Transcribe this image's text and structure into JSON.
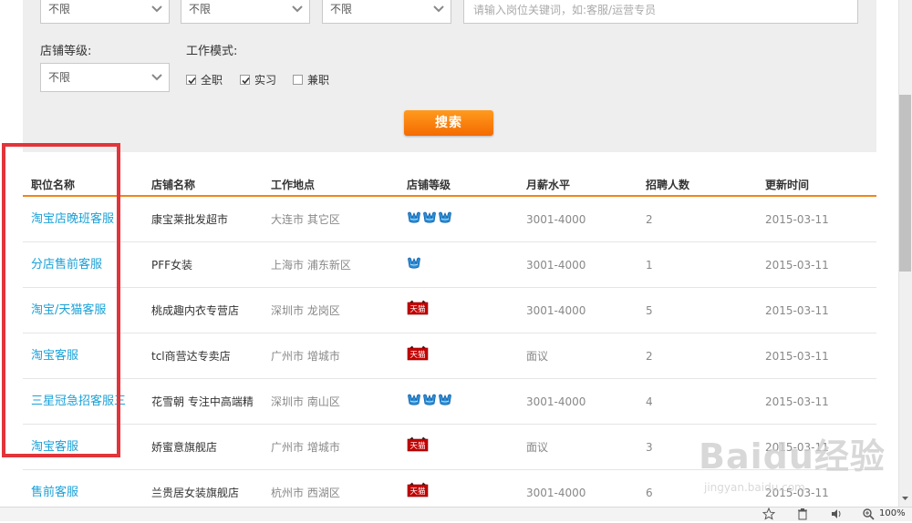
{
  "filters": {
    "top_selects": [
      "不限",
      "不限",
      "不限"
    ],
    "keyword_placeholder": "请输入岗位关键词，如:客服/运营专员",
    "shop_level_label": "店铺等级:",
    "shop_level_value": "不限",
    "work_mode_label": "工作模式:",
    "work_modes": [
      {
        "label": "全职",
        "checked": true
      },
      {
        "label": "实习",
        "checked": true
      },
      {
        "label": "兼职",
        "checked": false
      }
    ],
    "search_button": "搜索"
  },
  "table": {
    "headers": [
      "职位名称",
      "店铺名称",
      "工作地点",
      "店铺等级",
      "月薪水平",
      "招聘人数",
      "更新时间"
    ],
    "rows": [
      {
        "title": "淘宝店晚班客服",
        "shop": "康宝莱批发超市",
        "location": "大连市 其它区",
        "level": {
          "type": "crown",
          "count": 3
        },
        "salary": "3001-4000",
        "count": "2",
        "date": "2015-03-11"
      },
      {
        "title": "分店售前客服",
        "shop": "PFF女装",
        "location": "上海市 浦东新区",
        "level": {
          "type": "crown",
          "count": 1
        },
        "salary": "3001-4000",
        "count": "1",
        "date": "2015-03-11"
      },
      {
        "title": "淘宝/天猫客服",
        "shop": "桃成趣内衣专营店",
        "location": "深圳市 龙岗区",
        "level": {
          "type": "tmall",
          "count": 1
        },
        "salary": "3001-4000",
        "count": "5",
        "date": "2015-03-11"
      },
      {
        "title": "淘宝客服",
        "shop": "tcl商营达专卖店",
        "location": "广州市 增城市",
        "level": {
          "type": "tmall",
          "count": 1
        },
        "salary": "面议",
        "count": "2",
        "date": "2015-03-11"
      },
      {
        "title": "三星冠急招客服三",
        "shop": "花雪朝 专注中高端精",
        "location": "深圳市 南山区",
        "level": {
          "type": "crown",
          "count": 3
        },
        "salary": "3001-4000",
        "count": "4",
        "date": "2015-03-11"
      },
      {
        "title": "淘宝客服",
        "shop": "娇蜜意旗舰店",
        "location": "广州市 增城市",
        "level": {
          "type": "tmall",
          "count": 1
        },
        "salary": "面议",
        "count": "3",
        "date": "2015-03-11"
      },
      {
        "title": "售前客服",
        "shop": "兰贵居女装旗舰店",
        "location": "杭州市 西湖区",
        "level": {
          "type": "tmall",
          "count": 1
        },
        "salary": "3001-4000",
        "count": "6",
        "date": "2015-03-11"
      }
    ]
  },
  "tmall_badge_text": "天猫",
  "watermark": {
    "text": "Baidu经验",
    "sub": "jingyan.baidu.com"
  },
  "status_bar": {
    "zoom": "100%"
  },
  "colors": {
    "accent_orange": "#f08519",
    "link_blue": "#1aa1d8",
    "highlight_red": "#e2343a",
    "crown_blue": "#2b8fd8",
    "tmall_red": "#c40000"
  }
}
